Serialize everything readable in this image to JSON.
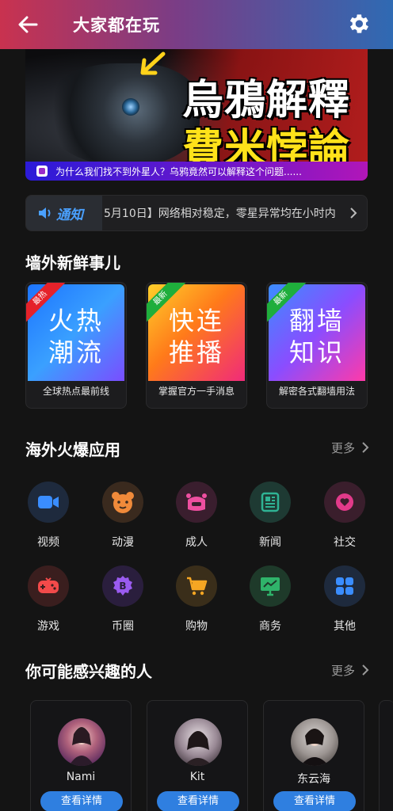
{
  "header": {
    "title": "大家都在玩",
    "back_icon": "arrow-left-icon",
    "settings_icon": "gear-icon"
  },
  "banner": {
    "line1": "烏鴉解釋",
    "line2": "費米悖論",
    "caption": "为什么我们找不到外星人？乌鸦竟然可以解释这个问题......"
  },
  "notice": {
    "label": "通知",
    "text": "5月10日】网络相对稳定，零星异常均在小时内"
  },
  "section_news": {
    "title": "墙外新鲜事儿"
  },
  "news_cards": [
    {
      "ribbon": "最热",
      "big1": "火热",
      "big2": "潮流",
      "sub": "全球热点最前线",
      "ribbon_color": "#e5222a"
    },
    {
      "ribbon": "最新",
      "big1": "快连",
      "big2": "推播",
      "sub": "掌握官方一手消息",
      "ribbon_color": "#1fae3c"
    },
    {
      "ribbon": "最新",
      "big1": "翻墙",
      "big2": "知识",
      "sub": "解密各式翻墙用法",
      "ribbon_color": "#1fae3c"
    }
  ],
  "section_apps": {
    "title": "海外火爆应用",
    "more": "更多"
  },
  "apps": [
    {
      "label": "视频",
      "icon": "video-camera-icon",
      "color": "#3a8dff"
    },
    {
      "label": "动漫",
      "icon": "bear-face-icon",
      "color": "#f08a3a"
    },
    {
      "label": "成人",
      "icon": "adult-icon",
      "color": "#ee4fa0"
    },
    {
      "label": "新闻",
      "icon": "newspaper-icon",
      "color": "#2fb394"
    },
    {
      "label": "社交",
      "icon": "heart-bubble-icon",
      "color": "#e23a8a"
    },
    {
      "label": "游戏",
      "icon": "gamepad-icon",
      "color": "#f24a4a"
    },
    {
      "label": "币圈",
      "icon": "bitcoin-icon",
      "color": "#9a5bf0"
    },
    {
      "label": "购物",
      "icon": "shopping-cart-icon",
      "color": "#f5a623"
    },
    {
      "label": "商务",
      "icon": "monitor-chart-icon",
      "color": "#2fb36a"
    },
    {
      "label": "其他",
      "icon": "grid-icon",
      "color": "#3a8dff"
    }
  ],
  "section_people": {
    "title": "你可能感兴趣的人",
    "more": "更多"
  },
  "people": [
    {
      "name": "Nami",
      "button": "查看详情"
    },
    {
      "name": "Kit",
      "button": "查看详情"
    },
    {
      "name": "东云海",
      "button": "查看详情"
    }
  ]
}
